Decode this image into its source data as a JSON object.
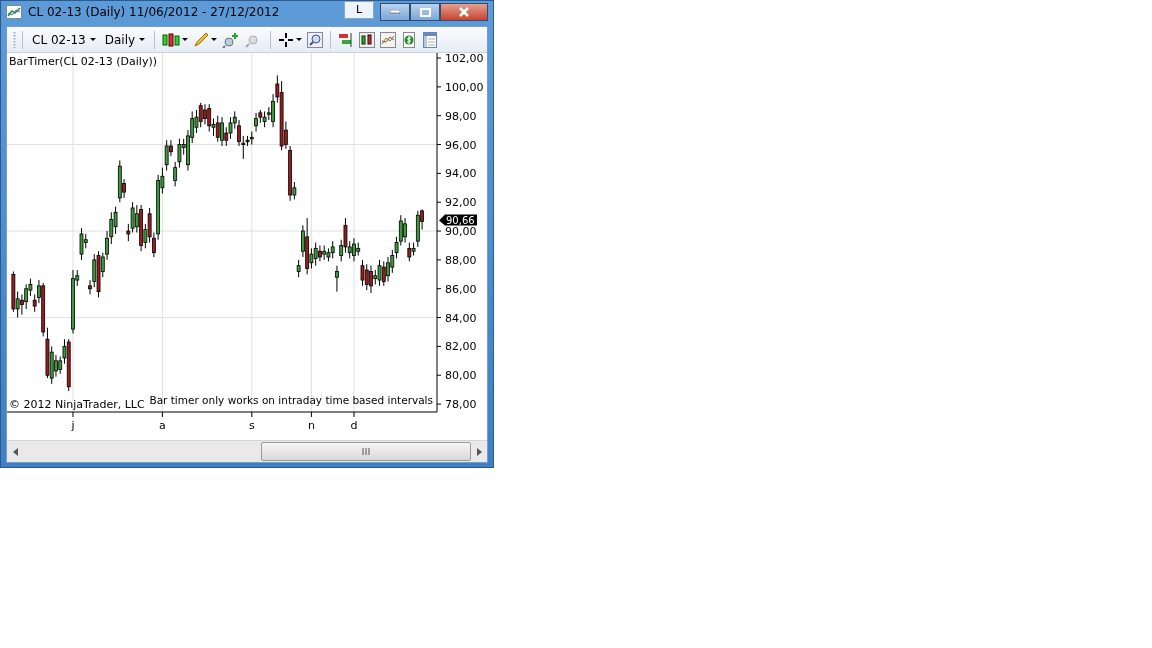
{
  "window": {
    "title": "CL 02-13 (Daily)  11/06/2012 - 27/12/2012",
    "caption_button": "L"
  },
  "toolbar": {
    "instrument": "CL 02-13",
    "period": "Daily"
  },
  "chart": {
    "indicator_label": "BarTimer(CL 02-13 (Daily))",
    "copyright": "© 2012 NinjaTrader, LLC",
    "message": "Bar timer only works on intraday time based intervals",
    "price_marker": "90,66",
    "chart_data": {
      "type": "candlestick",
      "grid": true,
      "ylim": [
        77.45,
        102.35
      ],
      "categories": [
        null,
        null,
        null,
        null,
        null,
        null,
        null,
        null,
        null,
        null,
        null,
        null,
        null,
        null,
        "j",
        null,
        null,
        null,
        null,
        null,
        null,
        null,
        null,
        null,
        null,
        null,
        null,
        null,
        null,
        null,
        null,
        null,
        null,
        null,
        null,
        "a",
        null,
        null,
        null,
        null,
        null,
        null,
        null,
        null,
        null,
        null,
        null,
        null,
        null,
        null,
        null,
        null,
        null,
        null,
        null,
        null,
        "s",
        null,
        null,
        null,
        null,
        null,
        null,
        null,
        null,
        null,
        null,
        null,
        null,
        null,
        "n",
        null,
        null,
        null,
        null,
        null,
        null,
        null,
        null,
        null,
        "d",
        null,
        null,
        null,
        null,
        null,
        null,
        null,
        null,
        null,
        null,
        null,
        null,
        null,
        null,
        null,
        null
      ],
      "yticks": [
        {
          "value": 78,
          "label": "78,00"
        },
        {
          "value": 80,
          "label": "80,00"
        },
        {
          "value": 82,
          "label": "82,00"
        },
        {
          "value": 84,
          "label": "84,00"
        },
        {
          "value": 86,
          "label": "86,00"
        },
        {
          "value": 88,
          "label": "88,00"
        },
        {
          "value": 90,
          "label": "90,00"
        },
        {
          "value": 92,
          "label": "92,00"
        },
        {
          "value": 94,
          "label": "94,00"
        },
        {
          "value": 96,
          "label": "96,00"
        },
        {
          "value": 98,
          "label": "98,00"
        },
        {
          "value": 100,
          "label": "100,00"
        },
        {
          "value": 102,
          "label": "102,00"
        }
      ],
      "ohlc": [
        [
          87.0,
          87.2,
          84.4,
          84.6
        ],
        [
          84.6,
          85.8,
          84.0,
          85.3
        ],
        [
          85.2,
          85.6,
          84.2,
          84.9
        ],
        [
          85.1,
          86.3,
          84.6,
          86.0
        ],
        [
          85.9,
          86.7,
          85.5,
          86.3
        ],
        [
          85.2,
          85.6,
          84.4,
          84.8
        ],
        [
          85.4,
          86.6,
          85.0,
          86.2
        ],
        [
          86.2,
          86.4,
          82.7,
          83.0
        ],
        [
          82.5,
          83.3,
          79.8,
          80.0
        ],
        [
          79.8,
          82.0,
          79.4,
          81.6
        ],
        [
          80.3,
          81.4,
          79.9,
          81.0
        ],
        [
          80.4,
          81.3,
          80.1,
          81.0
        ],
        [
          81.2,
          82.5,
          80.8,
          82.0
        ],
        [
          82.3,
          82.5,
          78.9,
          79.2
        ],
        [
          83.2,
          87.3,
          82.9,
          86.7
        ],
        [
          86.6,
          87.3,
          86.2,
          86.9
        ],
        [
          88.4,
          90.2,
          88.0,
          89.8
        ],
        [
          89.2,
          89.8,
          88.8,
          89.4
        ],
        [
          86.2,
          86.6,
          85.6,
          86.0
        ],
        [
          86.5,
          88.4,
          86.1,
          88.0
        ],
        [
          88.3,
          88.6,
          85.4,
          85.8
        ],
        [
          87.2,
          88.5,
          86.8,
          88.2
        ],
        [
          88.4,
          90.0,
          88.0,
          89.5
        ],
        [
          89.6,
          91.3,
          89.1,
          90.8
        ],
        [
          90.3,
          91.7,
          89.8,
          91.3
        ],
        [
          92.3,
          94.9,
          92.0,
          94.5
        ],
        [
          93.3,
          93.6,
          92.3,
          92.7
        ],
        [
          90.0,
          90.5,
          89.3,
          89.8
        ],
        [
          90.2,
          92.0,
          89.9,
          91.6
        ],
        [
          90.3,
          91.8,
          89.9,
          91.2
        ],
        [
          91.5,
          91.8,
          88.6,
          89.0
        ],
        [
          89.2,
          90.5,
          88.8,
          90.1
        ],
        [
          91.2,
          91.6,
          89.2,
          89.6
        ],
        [
          89.5,
          89.9,
          88.2,
          88.5
        ],
        [
          89.8,
          93.9,
          89.4,
          93.5
        ],
        [
          93.0,
          94.4,
          92.6,
          93.8
        ],
        [
          94.6,
          96.3,
          94.2,
          95.9
        ],
        [
          95.9,
          96.3,
          95.2,
          95.5
        ],
        [
          93.5,
          94.8,
          93.1,
          94.4
        ],
        [
          94.8,
          96.4,
          94.4,
          96.0
        ],
        [
          95.8,
          96.4,
          95.3,
          96.0
        ],
        [
          94.6,
          97.0,
          94.2,
          96.6
        ],
        [
          96.5,
          98.3,
          96.1,
          97.8
        ],
        [
          97.2,
          98.4,
          96.8,
          97.9
        ],
        [
          98.7,
          98.9,
          97.2,
          97.6
        ],
        [
          98.4,
          98.8,
          97.4,
          97.8
        ],
        [
          98.5,
          98.8,
          96.9,
          97.3
        ],
        [
          97.2,
          97.8,
          96.6,
          97.4
        ],
        [
          97.5,
          98.0,
          96.2,
          96.5
        ],
        [
          96.3,
          97.9,
          95.9,
          97.5
        ],
        [
          96.8,
          97.2,
          95.9,
          96.3
        ],
        [
          96.8,
          97.9,
          96.4,
          97.5
        ],
        [
          97.5,
          98.3,
          97.1,
          97.9
        ],
        [
          97.3,
          97.7,
          95.9,
          96.2
        ],
        [
          96.0,
          96.6,
          95.0,
          96.1
        ],
        [
          96.3,
          96.6,
          95.9,
          96.2
        ],
        [
          96.4,
          96.9,
          96.0,
          96.5
        ],
        [
          97.3,
          98.2,
          96.9,
          97.8
        ],
        [
          98.2,
          98.4,
          97.5,
          97.9
        ],
        [
          97.6,
          98.3,
          97.2,
          97.9
        ],
        [
          98.1,
          98.6,
          97.7,
          98.2
        ],
        [
          97.6,
          99.5,
          97.2,
          99.0
        ],
        [
          100.2,
          100.8,
          98.9,
          99.3
        ],
        [
          99.6,
          100.4,
          95.6,
          95.9
        ],
        [
          97.0,
          97.6,
          95.7,
          96.0
        ],
        [
          95.6,
          95.9,
          92.1,
          92.5
        ],
        [
          92.5,
          93.4,
          92.2,
          93.0
        ],
        [
          87.2,
          88.0,
          86.8,
          87.6
        ],
        [
          88.6,
          90.4,
          88.2,
          90.0
        ],
        [
          89.6,
          90.9,
          87.0,
          87.4
        ],
        [
          87.8,
          88.8,
          87.4,
          88.4
        ],
        [
          88.1,
          89.2,
          87.6,
          88.8
        ],
        [
          88.6,
          89.0,
          87.9,
          88.2
        ],
        [
          88.4,
          89.0,
          88.0,
          88.6
        ],
        [
          88.2,
          88.8,
          87.9,
          88.5
        ],
        [
          88.5,
          89.3,
          88.1,
          88.9
        ],
        [
          86.8,
          87.6,
          85.8,
          87.2
        ],
        [
          88.3,
          89.4,
          87.9,
          89.0
        ],
        [
          90.4,
          90.9,
          88.5,
          88.9
        ],
        [
          88.5,
          89.3,
          88.1,
          88.9
        ],
        [
          88.3,
          89.5,
          87.9,
          89.1
        ],
        [
          88.6,
          89.2,
          88.3,
          88.8
        ],
        [
          87.6,
          88.0,
          86.2,
          86.6
        ],
        [
          87.3,
          87.7,
          85.9,
          86.3
        ],
        [
          87.2,
          87.6,
          85.7,
          86.2
        ],
        [
          86.7,
          87.3,
          86.3,
          86.9
        ],
        [
          86.6,
          88.0,
          86.2,
          87.6
        ],
        [
          87.5,
          87.9,
          86.2,
          86.5
        ],
        [
          86.9,
          88.2,
          86.5,
          87.8
        ],
        [
          87.5,
          88.7,
          87.1,
          88.3
        ],
        [
          88.5,
          89.6,
          88.1,
          89.2
        ],
        [
          89.3,
          91.1,
          89.0,
          90.7
        ],
        [
          89.6,
          90.9,
          89.2,
          90.5
        ],
        [
          88.8,
          89.2,
          87.9,
          88.2
        ],
        [
          88.6,
          89.2,
          88.3,
          88.8
        ],
        [
          89.3,
          91.4,
          88.9,
          91.1
        ],
        [
          91.4,
          91.5,
          90.1,
          90.66
        ]
      ]
    }
  }
}
